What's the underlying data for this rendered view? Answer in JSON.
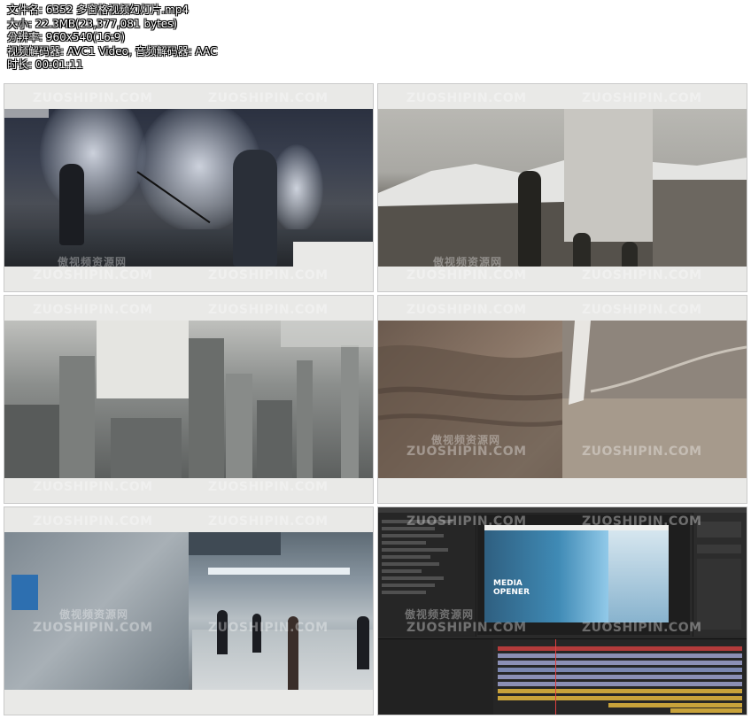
{
  "info": {
    "filename": "文件名: 6352 多窗格视频幻灯片.mp4",
    "size": "大小: 22.3MB(23,377,081 bytes)",
    "resolution": "分辨率: 960x540(16:9)",
    "codec": "视频解码器: AVC1 Video, 音频解码器: AAC",
    "duration": "时长: 00:01:11"
  },
  "watermark": {
    "cn": "傲视频资源网",
    "en": "ZUOSHIPIN.COM"
  },
  "ae": {
    "title_line1": "MEDIA",
    "title_line2": "OPENER"
  }
}
